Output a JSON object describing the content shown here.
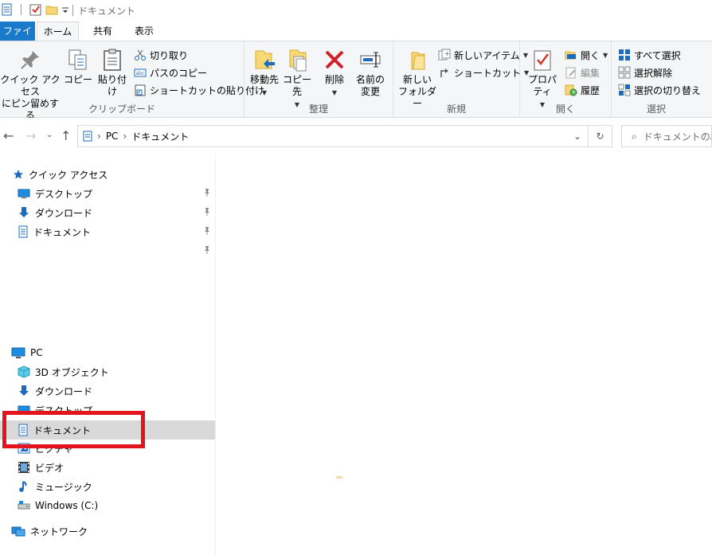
{
  "window": {
    "title": "ドキュメント"
  },
  "ribbon_tabs": [
    {
      "label": "ファイル"
    },
    {
      "label": "ホーム"
    },
    {
      "label": "共有"
    },
    {
      "label": "表示"
    }
  ],
  "ribbon": {
    "clipboard": {
      "label": "クリップボード",
      "pin_quick": "クイック アクセス\nにピン留めする",
      "copy": "コピー",
      "paste": "貼り付け",
      "cut": "切り取り",
      "copy_path": "パスのコピー",
      "paste_shortcut": "ショートカットの貼り付け"
    },
    "organize": {
      "label": "整理",
      "move_to": "移動先",
      "copy_to": "コピー先",
      "delete": "削除",
      "rename": "名前の\n変更"
    },
    "new": {
      "label": "新規",
      "new_folder": "新しい\nフォルダー",
      "new_item": "新しいアイテム",
      "shortcut": "ショートカット"
    },
    "open": {
      "label": "開く",
      "properties": "プロパティ",
      "open": "開く",
      "edit": "編集",
      "history": "履歴"
    },
    "select": {
      "label": "選択",
      "select_all": "すべて選択",
      "select_none": "選択解除",
      "invert": "選択の切り替え"
    }
  },
  "address": {
    "breadcrumb": [
      "PC",
      "ドキュメント"
    ],
    "search_placeholder": "ドキュメントの検"
  },
  "navpane": {
    "quick_access": {
      "label": "クイック アクセス",
      "items": [
        {
          "label": "デスクトップ",
          "icon": "desktop-icon"
        },
        {
          "label": "ダウンロード",
          "icon": "download-icon"
        },
        {
          "label": "ドキュメント",
          "icon": "document-icon"
        },
        {
          "label": "",
          "icon": ""
        }
      ]
    },
    "pc": {
      "label": "PC",
      "items": [
        {
          "label": "3D オブジェクト"
        },
        {
          "label": "ダウンロード"
        },
        {
          "label": "デスクトップ"
        },
        {
          "label": "ドキュメント"
        },
        {
          "label": "ピクチャ"
        },
        {
          "label": "ビデオ"
        },
        {
          "label": "ミュージック"
        },
        {
          "label": "Windows (C:)"
        }
      ]
    },
    "network": {
      "label": "ネットワーク"
    }
  },
  "colors": {
    "file_tab": "#1979ca",
    "highlight": "#e3141c",
    "selected_row": "#d9d9d9"
  }
}
